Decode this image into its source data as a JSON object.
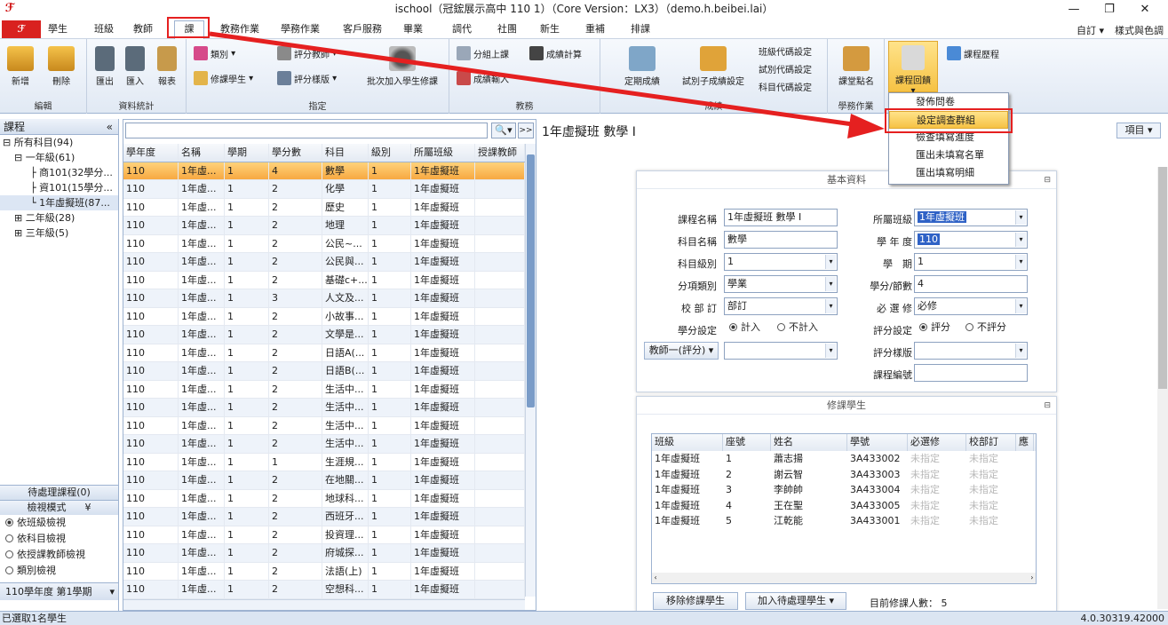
{
  "window": {
    "title": "ischool（冠鋐展示高中 110 1）（Core Version：LX3）（demo.h.beibei.lai）",
    "min": "—",
    "max": "❐",
    "close": "✕"
  },
  "menu": {
    "tabs": [
      "學生",
      "班級",
      "教師",
      "課程",
      "教務作業",
      "學務作業",
      "客戶服務",
      "畢業",
      "調代課",
      "社團",
      "新生",
      "重補修",
      "排課"
    ],
    "active": "課程",
    "custom": "自訂",
    "style": "樣式與色調"
  },
  "ribbon": {
    "edit": {
      "label": "編輯",
      "add": "新增",
      "delete": "刪除"
    },
    "stats": {
      "label": "資料統計",
      "export": "匯出",
      "import": "匯入",
      "report": "報表"
    },
    "assign": {
      "label": "指定",
      "category": "類別",
      "teacher": "評分教師",
      "students": "修課學生",
      "template": "評分樣版",
      "batch": "批次加入學生修課"
    },
    "academic": {
      "label": "教務",
      "group_class": "分組上課",
      "grade_calc": "成績計算",
      "grade_input": "成績輸入"
    },
    "grades": {
      "label": "成績",
      "entry_grade": "定期成績",
      "exam_settings": "試別子成績設定",
      "codes": [
        "班級代碼設定",
        "試別代碼設定",
        "科目代碼設定"
      ]
    },
    "attendance": {
      "label": "學務作業",
      "rollcall": "課堂點名"
    },
    "feedback": {
      "label": "課程回饋",
      "history": "課程歷程"
    }
  },
  "dropdown": {
    "items": [
      "發佈問卷",
      "設定調查群組",
      "檢查填寫進度",
      "匯出未填寫名單",
      "匯出填寫明細"
    ]
  },
  "left": {
    "title": "課程",
    "collapse": "«",
    "tree": [
      "所有科目(94)",
      "一年級(61)",
      "商101(32學分...",
      "資101(15學分...",
      "1年虛擬班(87...",
      "二年級(28)",
      "三年級(5)"
    ],
    "pending": "待處理課程(0)",
    "view_mode": "檢視模式",
    "view_options": [
      "依班級檢視",
      "依科目檢視",
      "依授課教師檢視",
      "類別檢視"
    ],
    "semester": "110學年度 第1學期"
  },
  "grid": {
    "columns": [
      "學年度",
      "名稱",
      "學期",
      "學分數",
      "科目",
      "級別",
      "所屬班級",
      "授課教師"
    ],
    "rows": [
      [
        "110",
        "1年虛...",
        "1",
        "4",
        "數學",
        "1",
        "1年虛擬班"
      ],
      [
        "110",
        "1年虛...",
        "1",
        "2",
        "化學",
        "1",
        "1年虛擬班"
      ],
      [
        "110",
        "1年虛...",
        "1",
        "2",
        "歷史",
        "1",
        "1年虛擬班"
      ],
      [
        "110",
        "1年虛...",
        "1",
        "2",
        "地理",
        "1",
        "1年虛擬班"
      ],
      [
        "110",
        "1年虛...",
        "1",
        "2",
        "公民~...",
        "1",
        "1年虛擬班"
      ],
      [
        "110",
        "1年虛...",
        "1",
        "2",
        "公民與...",
        "1",
        "1年虛擬班"
      ],
      [
        "110",
        "1年虛...",
        "1",
        "2",
        "基礎c+...",
        "1",
        "1年虛擬班"
      ],
      [
        "110",
        "1年虛...",
        "1",
        "3",
        "人文及...",
        "1",
        "1年虛擬班"
      ],
      [
        "110",
        "1年虛...",
        "1",
        "2",
        "小故事...",
        "1",
        "1年虛擬班"
      ],
      [
        "110",
        "1年虛...",
        "1",
        "2",
        "文學是...",
        "1",
        "1年虛擬班"
      ],
      [
        "110",
        "1年虛...",
        "1",
        "2",
        "日語A(...",
        "1",
        "1年虛擬班"
      ],
      [
        "110",
        "1年虛...",
        "1",
        "2",
        "日語B(...",
        "1",
        "1年虛擬班"
      ],
      [
        "110",
        "1年虛...",
        "1",
        "2",
        "生活中...",
        "1",
        "1年虛擬班"
      ],
      [
        "110",
        "1年虛...",
        "1",
        "2",
        "生活中...",
        "1",
        "1年虛擬班"
      ],
      [
        "110",
        "1年虛...",
        "1",
        "2",
        "生活中...",
        "1",
        "1年虛擬班"
      ],
      [
        "110",
        "1年虛...",
        "1",
        "2",
        "生活中...",
        "1",
        "1年虛擬班"
      ],
      [
        "110",
        "1年虛...",
        "1",
        "1",
        "生涯規...",
        "1",
        "1年虛擬班"
      ],
      [
        "110",
        "1年虛...",
        "1",
        "2",
        "在地關...",
        "1",
        "1年虛擬班"
      ],
      [
        "110",
        "1年虛...",
        "1",
        "2",
        "地球科...",
        "1",
        "1年虛擬班"
      ],
      [
        "110",
        "1年虛...",
        "1",
        "2",
        "西班牙...",
        "1",
        "1年虛擬班"
      ],
      [
        "110",
        "1年虛...",
        "1",
        "2",
        "投資理...",
        "1",
        "1年虛擬班"
      ],
      [
        "110",
        "1年虛...",
        "1",
        "2",
        "府城探...",
        "1",
        "1年虛擬班"
      ],
      [
        "110",
        "1年虛...",
        "1",
        "2",
        "法語(上)",
        "1",
        "1年虛擬班"
      ],
      [
        "110",
        "1年虛...",
        "1",
        "2",
        "空想科...",
        "1",
        "1年虛擬班"
      ]
    ]
  },
  "detail": {
    "title": "1年虛擬班 數學 I",
    "items_btn": "項目",
    "basic": {
      "header": "基本資料",
      "course_name_label": "課程名稱",
      "course_name": "1年虛擬班 數學 I",
      "class_label": "所屬班級",
      "class": "1年虛擬班",
      "subject_label": "科目名稱",
      "subject": "數學",
      "year_label": "學 年 度",
      "year": "110",
      "level_label": "科目級別",
      "level": "1",
      "sem_label": "學　期",
      "sem": "1",
      "cat_label": "分項類別",
      "cat": "學業",
      "credit_label": "學分/節數",
      "credit": "4",
      "school_label": "校 部 訂",
      "school": "部訂",
      "req_label": "必 選 修",
      "req": "必修",
      "credit_set_label": "學分設定",
      "credit_in": "計入",
      "credit_out": "不計入",
      "score_set_label": "評分設定",
      "score_yes": "評分",
      "score_no": "不評分",
      "teacher_btn": "教師一(評分)",
      "template_label": "評分樣版",
      "code_label": "課程編號"
    },
    "students": {
      "header": "修課學生",
      "columns": [
        "班級",
        "座號",
        "姓名",
        "學號",
        "必選修",
        "校部訂",
        "應"
      ],
      "rows": [
        [
          "1年虛擬班",
          "1",
          "蕭志揚",
          "3A433002",
          "未指定",
          "未指定"
        ],
        [
          "1年虛擬班",
          "2",
          "謝云智",
          "3A433003",
          "未指定",
          "未指定"
        ],
        [
          "1年虛擬班",
          "3",
          "李帥帥",
          "3A433004",
          "未指定",
          "未指定"
        ],
        [
          "1年虛擬班",
          "4",
          "王在聖",
          "3A433005",
          "未指定",
          "未指定"
        ],
        [
          "1年虛擬班",
          "5",
          "江乾能",
          "3A433001",
          "未指定",
          "未指定"
        ]
      ],
      "remove_btn": "移除修課學生",
      "add_btn": "加入待處理學生",
      "count": "目前修課人數：  5"
    }
  },
  "status": {
    "left": "已選取1名學生",
    "right": "4.0.30319.42000"
  },
  "colors": {
    "selected_row": "#f7a941",
    "accent_red": "#e52020",
    "ribbon_bg": "#e1e9f4"
  }
}
